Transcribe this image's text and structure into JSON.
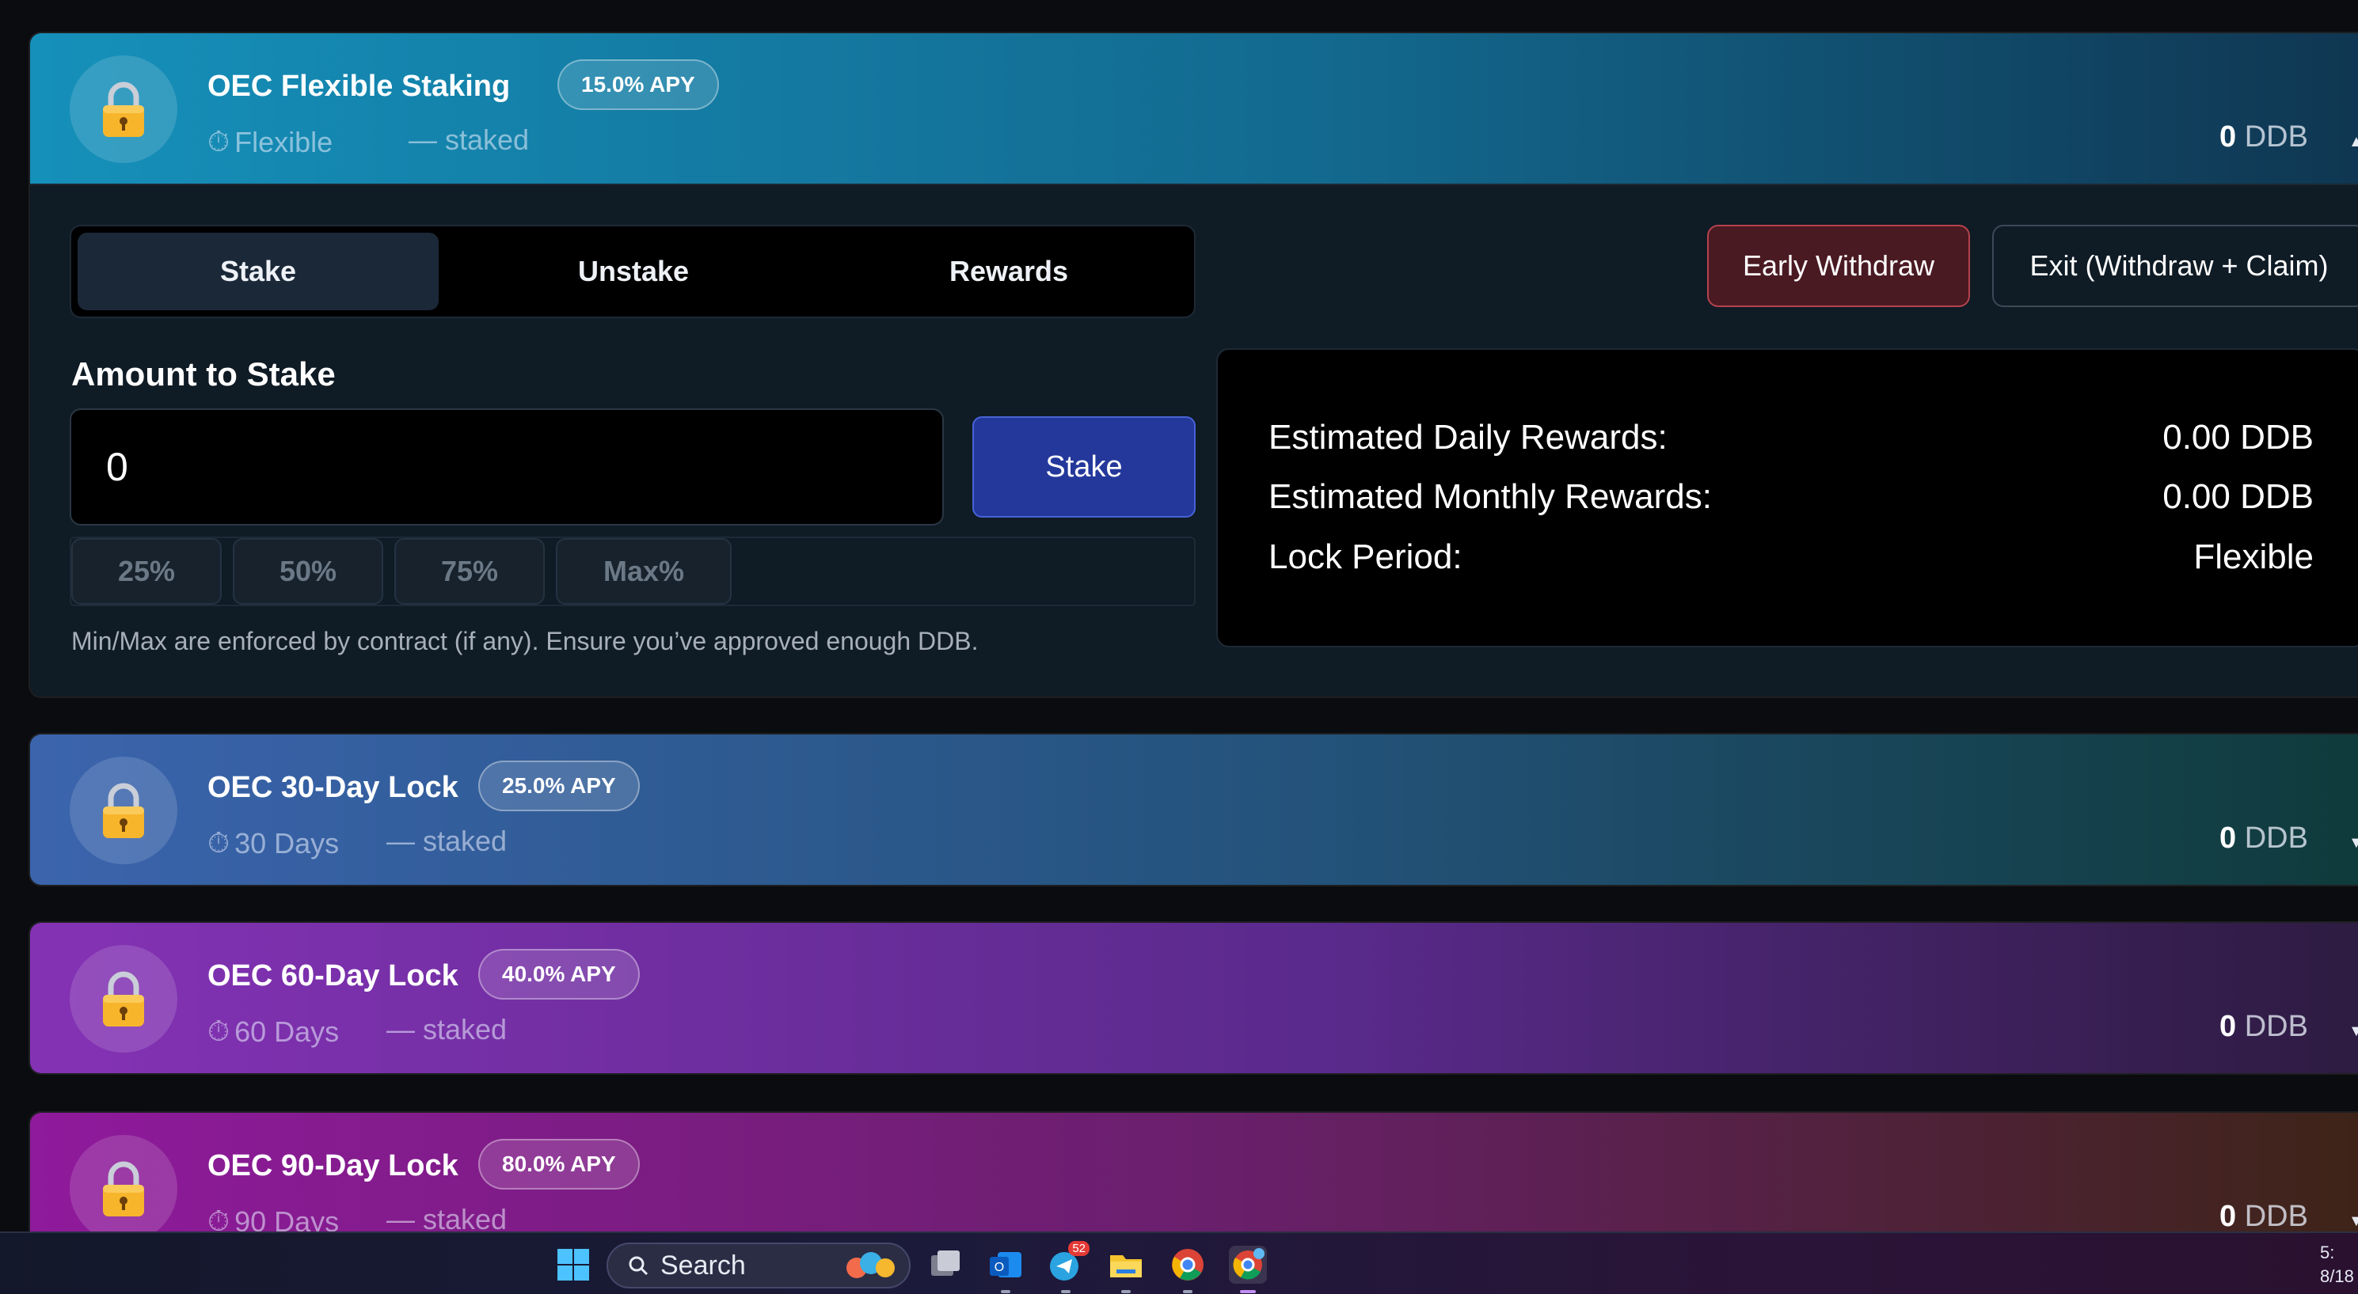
{
  "currency": "DDB",
  "pools": [
    {
      "name": "OEC Flexible Staking",
      "apy": "15.0% APY",
      "period": "Flexible",
      "staked": "— staked",
      "amount": "0",
      "unit": "DDB",
      "expanded": true,
      "gradient_from": "#1590ba",
      "gradient_to": "#0f3550"
    },
    {
      "name": "OEC 30-Day Lock",
      "apy": "25.0% APY",
      "period": "30 Days",
      "staked": "— staked",
      "amount": "0",
      "unit": "DDB",
      "expanded": false,
      "gradient_from": "#3b64ad",
      "gradient_to": "#0f3a3a"
    },
    {
      "name": "OEC 60-Day Lock",
      "apy": "40.0% APY",
      "period": "60 Days",
      "staked": "— staked",
      "amount": "0",
      "unit": "DDB",
      "expanded": false,
      "gradient_from": "#8432b4",
      "gradient_to": "#2c1b3f"
    },
    {
      "name": "OEC 90-Day Lock",
      "apy": "80.0% APY",
      "period": "90 Days",
      "staked": "— staked",
      "amount": "0",
      "unit": "DDB",
      "expanded": false,
      "gradient_from": "#8f1a9c",
      "gradient_to": "#3d2416"
    }
  ],
  "tabs": [
    "Stake",
    "Unstake",
    "Rewards"
  ],
  "active_tab": "Stake",
  "actions": {
    "early_withdraw": "Early Withdraw",
    "exit": "Exit (Withdraw + Claim)"
  },
  "stake_form": {
    "label": "Amount to Stake",
    "value": "0",
    "button": "Stake",
    "percent_options": [
      "25%",
      "50%",
      "75%",
      "Max%"
    ],
    "note": "Min/Max are enforced by contract (if any). Ensure you’ve approved enough DDB."
  },
  "estimates": [
    {
      "label": "Estimated Daily Rewards:",
      "value": "0.00 DDB"
    },
    {
      "label": "Estimated Monthly Rewards:",
      "value": "0.00 DDB"
    },
    {
      "label": "Lock Period:",
      "value": "Flexible"
    }
  ],
  "taskbar": {
    "search_label": "Search",
    "telegram_badge": "52",
    "clock_time": "5:",
    "clock_date": "8/18"
  },
  "icons": {
    "lock": "lock-icon",
    "timer": "stopwatch-icon",
    "caret_up": "caret-up-icon",
    "caret_down": "caret-down-icon"
  }
}
